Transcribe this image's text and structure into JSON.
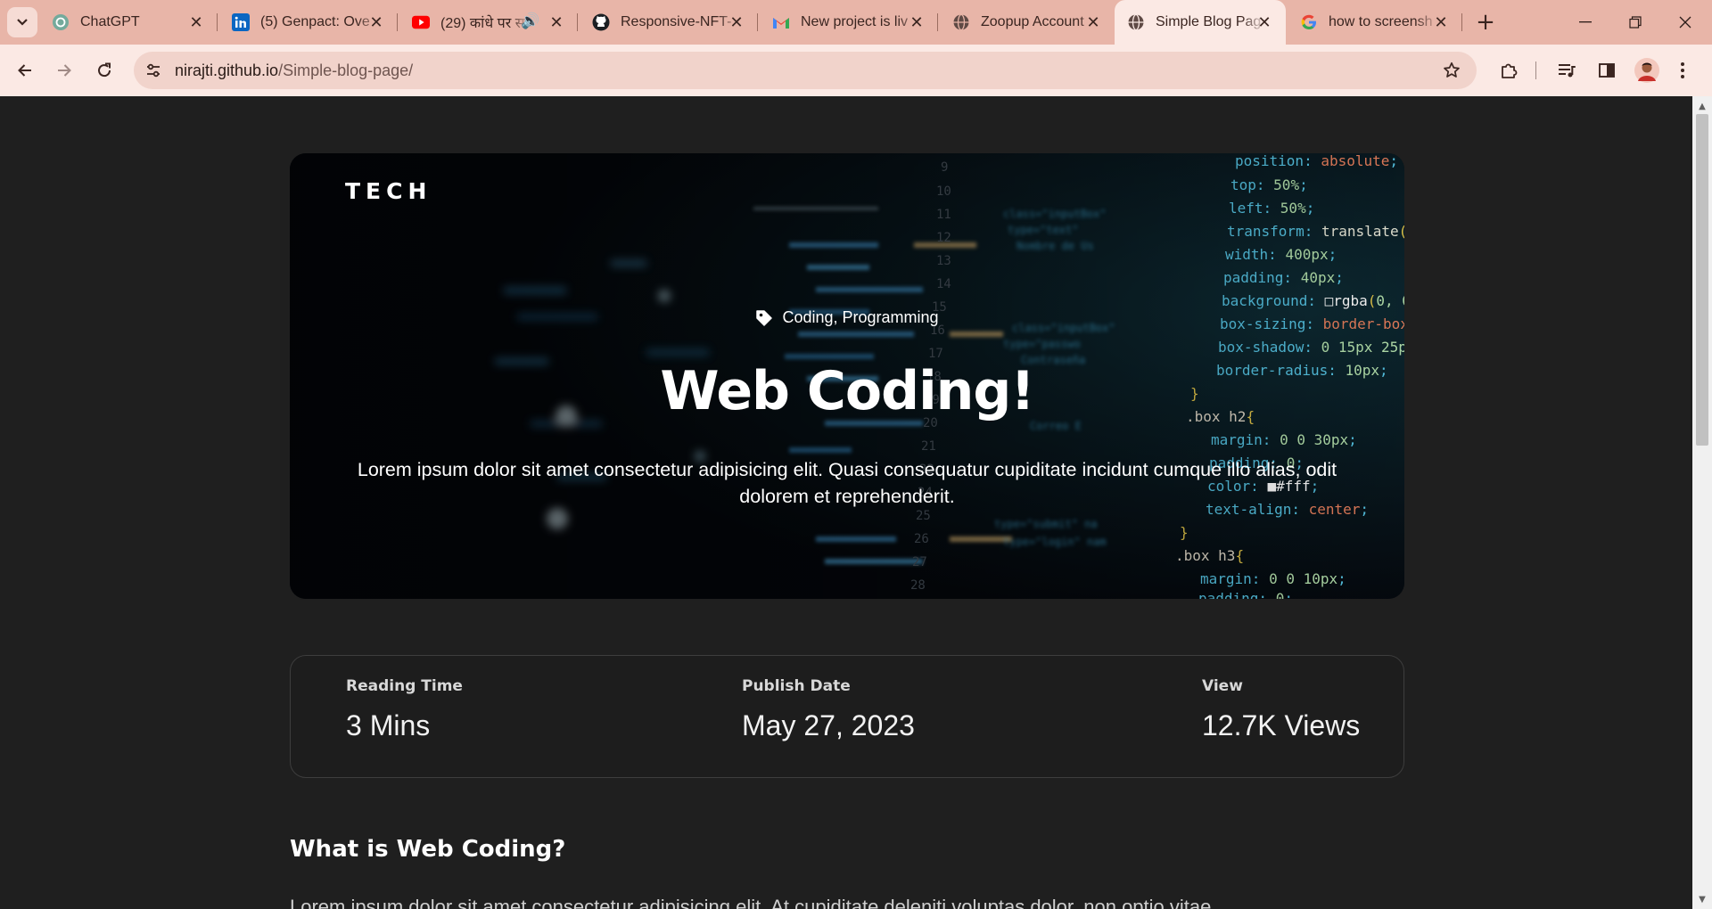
{
  "browser": {
    "tabs": [
      {
        "title": "ChatGPT",
        "icon": "chatgpt-icon",
        "active": false
      },
      {
        "title": "(5) Genpact: Ove",
        "icon": "linkedin-icon",
        "active": false
      },
      {
        "title": "(29) कांधे पर स",
        "icon": "youtube-icon",
        "active": false,
        "audio": true
      },
      {
        "title": "Responsive-NFT-",
        "icon": "github-icon",
        "active": false
      },
      {
        "title": "New project is liv",
        "icon": "gmail-icon",
        "active": false
      },
      {
        "title": "Zoopup Account",
        "icon": "globe-icon",
        "active": false
      },
      {
        "title": "Simple Blog Pag",
        "icon": "globe-icon",
        "active": true
      },
      {
        "title": "how to screensh",
        "icon": "google-icon",
        "active": false
      }
    ],
    "url_host": "nirajti.github.io",
    "url_path": "/Simple-blog-page/"
  },
  "hero": {
    "logo": "TECH",
    "tags": "Coding, Programming",
    "title": "Web Coding!",
    "lead": "Lorem ipsum dolor sit amet consectetur adipisicing elit. Quasi consequatur cupiditate incidunt cumque illo alias, odit dolorem et reprehenderit."
  },
  "stats": {
    "reading_label": "Reading Time",
    "reading_value": "3 Mins",
    "publish_label": "Publish Date",
    "publish_value": "May 27, 2023",
    "view_label": "View",
    "view_value": "12.7K Views"
  },
  "article": {
    "heading": "What is Web Coding?",
    "body": "Lorem ipsum dolor sit amet consectetur adipisicing elit. At cupiditate deleniti voluptas dolor, non optio vitae"
  },
  "colors": {
    "tabbar": "#e8b5a8",
    "toolbar": "#fbe9e4",
    "page_bg": "#1f1f1f",
    "card_border": "#3d3d3d"
  }
}
